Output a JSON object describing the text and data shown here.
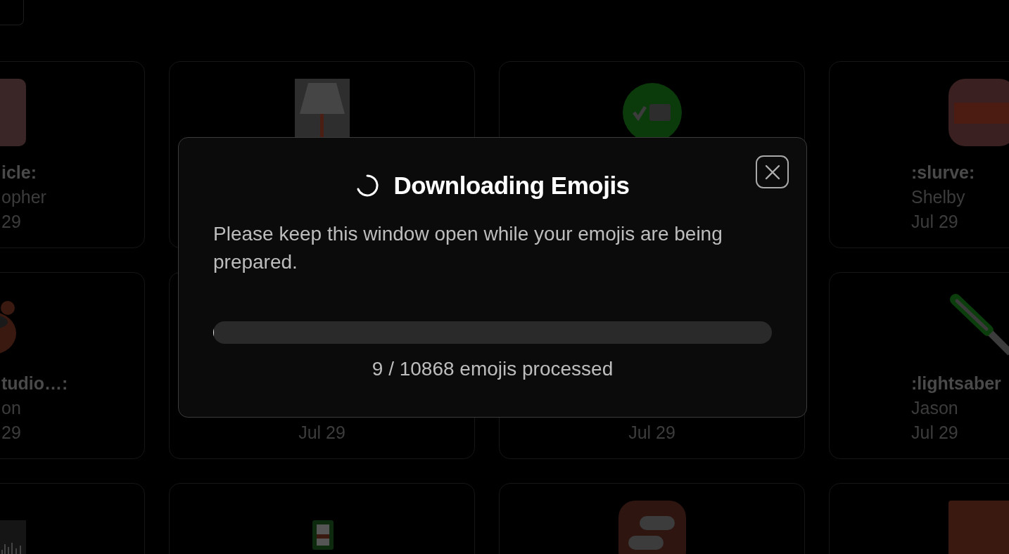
{
  "grid": {
    "rows": [
      [
        {
          "name": "icle:",
          "author": "opher",
          "date": "29"
        },
        {},
        {},
        {
          "name": ":slurve:",
          "author": "Shelby",
          "date": "Jul 29"
        }
      ],
      [
        {
          "name": "tudio…:",
          "author": "on",
          "date": "29"
        },
        {
          "date": "Jul 29"
        },
        {
          "date": "Jul 29"
        },
        {
          "name": ":lightsaber",
          "author": "Jason",
          "date": "Jul 29"
        }
      ],
      [
        {},
        {},
        {},
        {}
      ]
    ]
  },
  "modal": {
    "title": "Downloading Emojis",
    "message": "Please keep this window open while your emojis are being prepared.",
    "progress": {
      "level": 0.0008
    },
    "status": "9 / 10868 emojis processed"
  }
}
